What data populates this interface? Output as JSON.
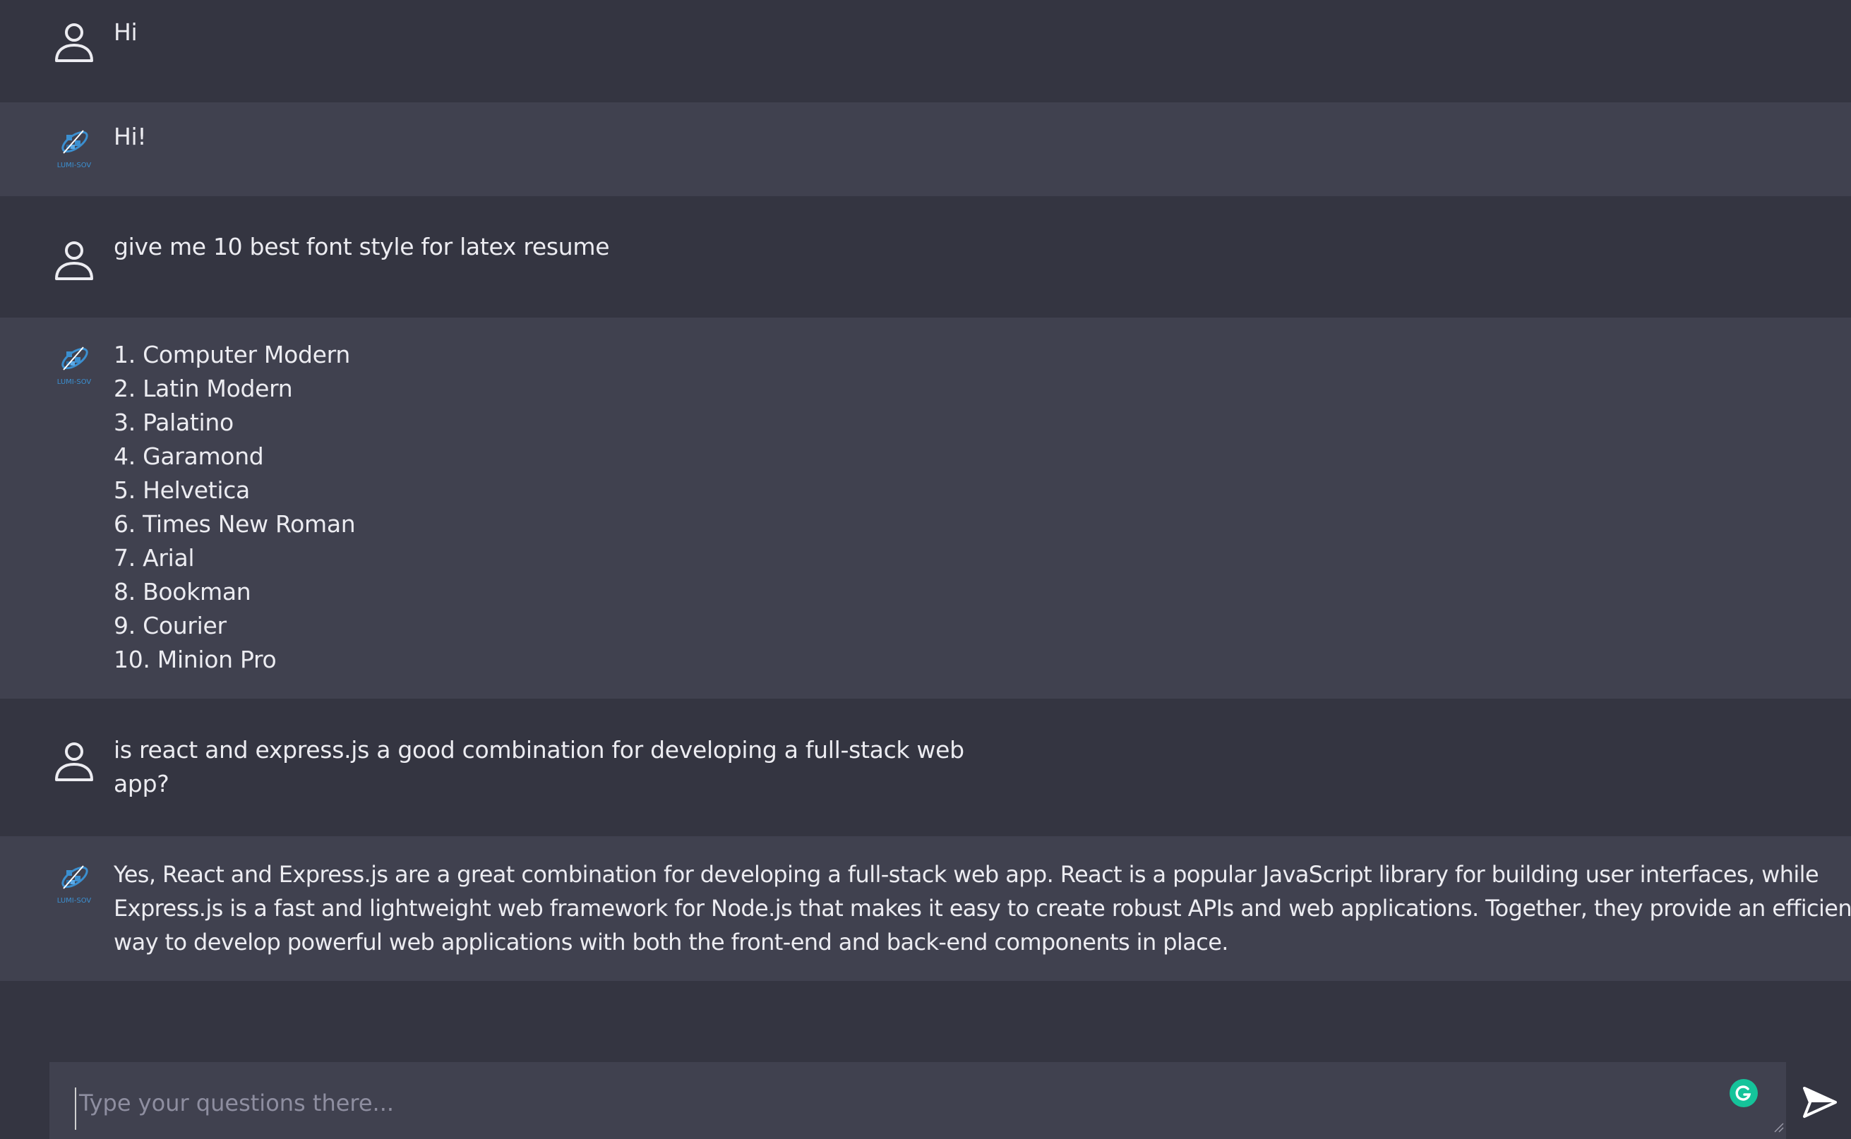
{
  "conversation": [
    {
      "role": "user",
      "icon": "user-icon",
      "text": "Hi"
    },
    {
      "role": "bot",
      "icon": "lumisov-logo-icon",
      "logo_text": "LUMI-SOV",
      "text": "Hi!"
    },
    {
      "role": "user",
      "icon": "user-icon",
      "text": "give me 10 best font style for latex resume"
    },
    {
      "role": "bot",
      "icon": "lumisov-logo-icon",
      "logo_text": "LUMI-SOV",
      "list": [
        "1. Computer Modern",
        "2. Latin Modern",
        "3. Palatino",
        "4. Garamond",
        "5. Helvetica",
        "6. Times New Roman",
        "7. Arial",
        "8. Bookman",
        "9. Courier",
        "10. Minion Pro"
      ]
    },
    {
      "role": "user",
      "icon": "user-icon",
      "lines": [
        "is react and express.js a good combination for developing a full-stack web",
        "app?"
      ]
    },
    {
      "role": "bot",
      "icon": "lumisov-logo-icon",
      "logo_text": "LUMI-SOV",
      "lines": [
        "Yes, React and Express.js are a great combination for developing a full-stack web app. React is a popular JavaScript library for building user interfaces, while",
        "Express.js is a fast and lightweight web framework for Node.js that makes it easy to create robust APIs and web applications. Together, they provide an efficient",
        "way to develop powerful web applications with both the front-end and back-end components in place."
      ]
    }
  ],
  "composer": {
    "placeholder": "Type your questions there...",
    "grammarly_icon": "grammarly-icon",
    "send_icon": "send-icon"
  },
  "colors": {
    "user_row": "#343541",
    "bot_row": "#40414f",
    "text": "#ececf1",
    "logo_blue": "#3b8fd0"
  }
}
